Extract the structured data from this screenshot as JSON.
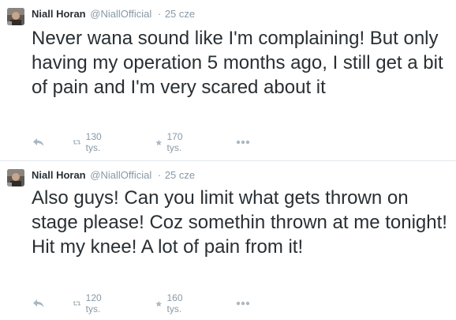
{
  "tweets": [
    {
      "author": {
        "name": "Niall Horan",
        "handle": "@NiallOfficial"
      },
      "separator": "·",
      "time": "25 cze",
      "text": "Never wana sound like I'm complaining! But only having my operation 5 months ago, I still get a bit of pain and I'm very scared about it",
      "actions": {
        "reply_icon": "reply-icon",
        "retweet_icon": "retweet-icon",
        "retweet_count": "130 tys.",
        "favorite_icon": "star-icon",
        "favorite_count": "170 tys.",
        "more_icon": "ellipsis-icon"
      }
    },
    {
      "author": {
        "name": "Niall Horan",
        "handle": "@NiallOfficial"
      },
      "separator": "·",
      "time": "25 cze",
      "text": "Also guys! Can you limit what gets thrown on stage please! Coz somethin thrown at me tonight! Hit my knee! A lot of pain from it!",
      "actions": {
        "reply_icon": "reply-icon",
        "retweet_icon": "retweet-icon",
        "retweet_count": "120 tys.",
        "favorite_icon": "star-icon",
        "favorite_count": "160 tys.",
        "more_icon": "ellipsis-icon"
      }
    }
  ],
  "colors": {
    "text": "#292f33",
    "muted": "#8899a6",
    "icon": "#aab8c2",
    "divider": "#e1e8ed"
  }
}
